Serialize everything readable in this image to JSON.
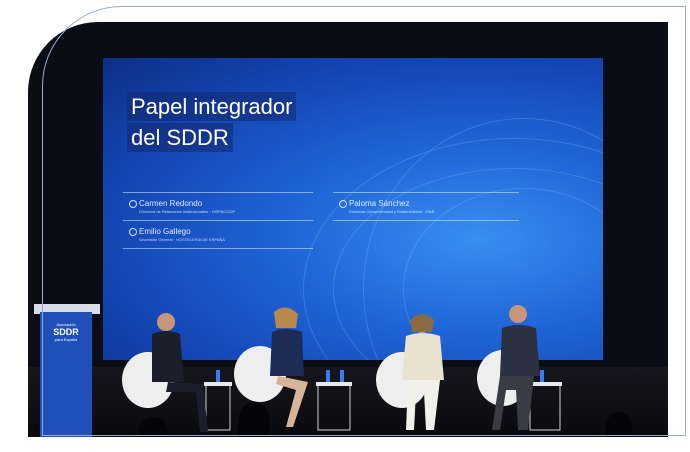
{
  "slide": {
    "title_line1": "Papel integrador",
    "title_line2": "del SDDR",
    "speakers": [
      {
        "name": "Carmen Redondo",
        "role": "Directora de Relaciones Institucionales · HISPACOOP"
      },
      {
        "name": "Emilio Gallego",
        "role": "Secretario General · HOSTELERÍA DE ESPAÑA"
      },
      {
        "name": "Paloma Sánchez",
        "role": "Directora Competitividad y Sostenibilidad · FIAB"
      }
    ]
  },
  "podium": {
    "line1": "Asociación",
    "line2": "SDDR",
    "line3": "para España"
  },
  "colors": {
    "screen_blue": "#1f66d8",
    "podium_blue": "#1f4fb8",
    "outline": "#9aa7d6"
  }
}
